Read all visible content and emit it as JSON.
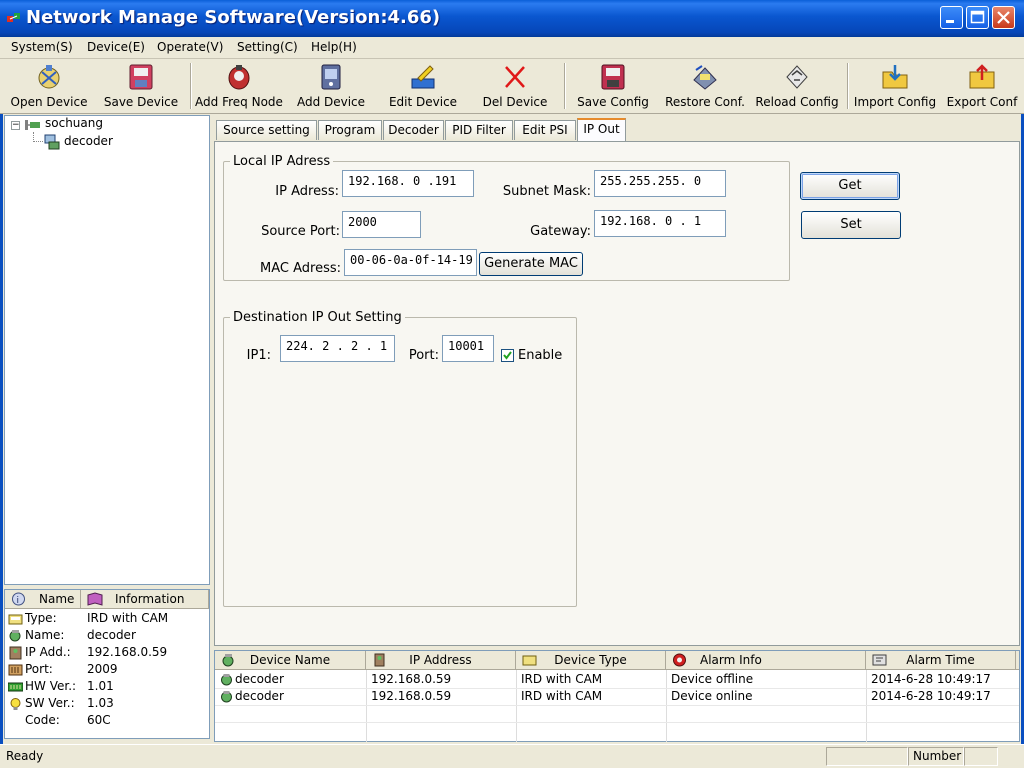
{
  "window": {
    "title": "Network Manage Software(Version:4.66)"
  },
  "menu": {
    "items": [
      "System(S)",
      "Device(E)",
      "Operate(V)",
      "Setting(C)",
      "Help(H)"
    ]
  },
  "toolbar": {
    "buttons": [
      {
        "label": "Open Device",
        "icon": "open-device-icon"
      },
      {
        "label": "Save Device",
        "icon": "save-device-icon"
      },
      {
        "label": "Add Freq Node",
        "icon": "add-freq-node-icon"
      },
      {
        "label": "Add Device",
        "icon": "add-device-icon"
      },
      {
        "label": "Edit Device",
        "icon": "edit-device-icon"
      },
      {
        "label": "Del Device",
        "icon": "delete-icon"
      },
      {
        "label": "Save Config",
        "icon": "save-config-icon"
      },
      {
        "label": "Restore Conf.",
        "icon": "restore-config-icon"
      },
      {
        "label": "Reload Config",
        "icon": "reload-config-icon"
      },
      {
        "label": "Import Config",
        "icon": "import-config-icon"
      },
      {
        "label": "Export Conf",
        "icon": "export-config-icon"
      }
    ]
  },
  "tree": {
    "root": {
      "label": "sochuang",
      "expander": "⊟"
    },
    "child": {
      "label": "decoder"
    }
  },
  "info_panel": {
    "headers": [
      "Name",
      "Information"
    ],
    "rows": [
      {
        "key": "Type:",
        "value": "IRD with CAM",
        "icon": "type-icon"
      },
      {
        "key": "Name:",
        "value": "decoder",
        "icon": "name-icon"
      },
      {
        "key": "IP Add.:",
        "value": "192.168.0.59",
        "icon": "ip-icon"
      },
      {
        "key": "Port:",
        "value": "2009",
        "icon": "port-icon"
      },
      {
        "key": "HW Ver.:",
        "value": "1.01",
        "icon": "hardware-icon"
      },
      {
        "key": "SW Ver.:",
        "value": "1.03",
        "icon": "bulb-icon"
      },
      {
        "key": "Code:",
        "value": "60C",
        "icon": ""
      }
    ]
  },
  "tabs": {
    "items": [
      "Source setting",
      "Program",
      "Decoder",
      "PID Filter",
      "Edit PSI",
      "IP Out"
    ],
    "active": "IP Out"
  },
  "local_ip": {
    "legend": "Local IP Adress",
    "ip_label": "IP Adress:",
    "ip_value": "192.168. 0 .191",
    "subnet_label": "Subnet Mask:",
    "subnet_value": "255.255.255. 0",
    "source_port_label": "Source Port:",
    "source_port_value": "2000",
    "gateway_label": "Gateway:",
    "gateway_value": "192.168. 0 . 1",
    "mac_label": "MAC Adress:",
    "mac_value": "00-06-0a-0f-14-19",
    "generate_mac_label": "Generate MAC"
  },
  "actions": {
    "get_label": "Get",
    "set_label": "Set"
  },
  "destination": {
    "legend": "Destination IP Out Setting",
    "ip1_label": "IP1:",
    "ip1_value": "224. 2 . 2 . 1",
    "port_label": "Port:",
    "port_value": "10001",
    "enable_label": "Enable",
    "enable_checked": true
  },
  "device_list": {
    "columns": [
      {
        "label": "Device Name",
        "icon": "device-name-icon"
      },
      {
        "label": "IP Address",
        "icon": "ip-address-icon"
      },
      {
        "label": "Device Type",
        "icon": "device-type-icon"
      },
      {
        "label": "Alarm Info",
        "icon": "alarm-icon"
      },
      {
        "label": "Alarm Time",
        "icon": "alarm-time-icon"
      }
    ],
    "rows": [
      [
        "decoder",
        "192.168.0.59",
        "IRD with CAM",
        "Device offline",
        "2014-6-28 10:49:17"
      ],
      [
        "decoder",
        "192.168.0.59",
        "IRD with CAM",
        "Device online",
        "2014-6-28 10:49:17"
      ]
    ]
  },
  "status": {
    "text": "Ready",
    "number_label": "Number"
  },
  "colors": {
    "title_bar": "#0a57d0",
    "active_tab_accent": "#e68b2c",
    "close_button": "#c8391a"
  }
}
